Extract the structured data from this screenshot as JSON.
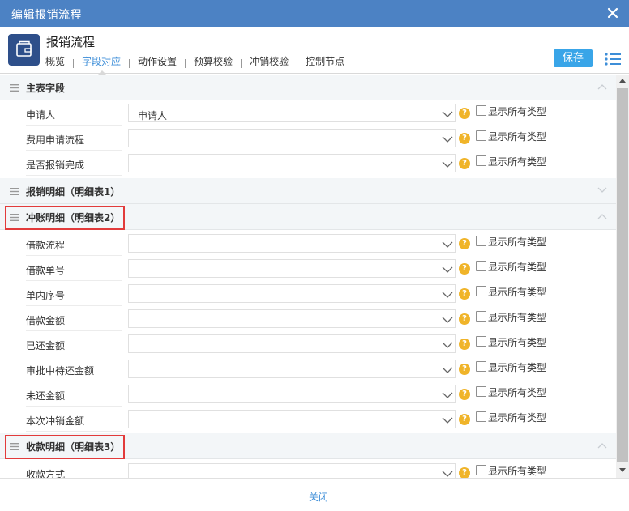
{
  "window": {
    "title": "编辑报销流程"
  },
  "header": {
    "app_name": "报销流程",
    "tabs": [
      {
        "label": "概览"
      },
      {
        "label": "字段对应"
      },
      {
        "label": "动作设置"
      },
      {
        "label": "预算校验"
      },
      {
        "label": "冲销校验"
      },
      {
        "label": "控制节点"
      }
    ],
    "active_tab": "字段对应",
    "save_label": "保存"
  },
  "sections": {
    "main": {
      "label": "主表字段",
      "rows": [
        {
          "field": "申请人",
          "value": "申请人",
          "checkbox_label": "显示所有类型"
        },
        {
          "field": "费用申请流程",
          "value": "",
          "checkbox_label": "显示所有类型"
        },
        {
          "field": "是否报销完成",
          "value": "",
          "checkbox_label": "显示所有类型"
        }
      ]
    },
    "detail1": {
      "label": "报销明细（明细表1）"
    },
    "detail2": {
      "label": "冲账明细（明细表2）",
      "rows": [
        {
          "field": "借款流程",
          "value": "",
          "checkbox_label": "显示所有类型"
        },
        {
          "field": "借款单号",
          "value": "",
          "checkbox_label": "显示所有类型"
        },
        {
          "field": "单内序号",
          "value": "",
          "checkbox_label": "显示所有类型"
        },
        {
          "field": "借款金额",
          "value": "",
          "checkbox_label": "显示所有类型"
        },
        {
          "field": "已还金额",
          "value": "",
          "checkbox_label": "显示所有类型"
        },
        {
          "field": "审批中待还金额",
          "value": "",
          "checkbox_label": "显示所有类型"
        },
        {
          "field": "未还金额",
          "value": "",
          "checkbox_label": "显示所有类型"
        },
        {
          "field": "本次冲销金额",
          "value": "",
          "checkbox_label": "显示所有类型"
        }
      ]
    },
    "detail3": {
      "label": "收款明细（明细表3）",
      "rows": [
        {
          "field": "收款方式",
          "value": "",
          "checkbox_label": "显示所有类型"
        }
      ]
    }
  },
  "help_glyph": "?",
  "footer": {
    "close_label": "关闭"
  },
  "colors": {
    "titlebar": "#4c82c4",
    "accent": "#39a5e8",
    "link": "#3d8ed8",
    "help": "#f0b429",
    "highlight_box": "#e23b3b"
  }
}
